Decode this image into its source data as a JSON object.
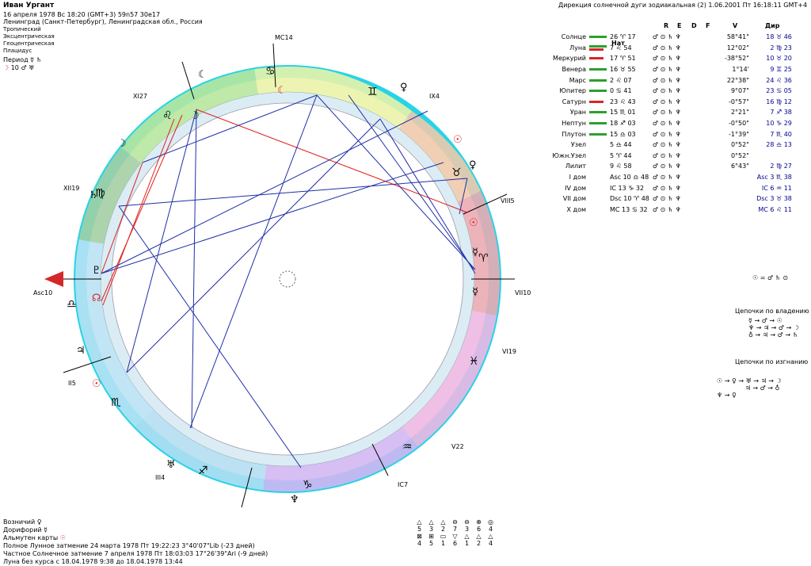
{
  "header": {
    "name": "Иван Ургант",
    "date_line": "16 апреля 1978  Вс  18:20 (GMT+3) 59n57  30e17",
    "place_line": "Ленинград (Санкт-Петербург), Ленинградская обл., Россия"
  },
  "settings": [
    "Тропический",
    "Эксцентрическая",
    "Геоцентрическая",
    "Плацидус"
  ],
  "period": {
    "label": "Период",
    "value": "10"
  },
  "direction_title": "Дирекция солнечной дуги зодиакальная (2)  1.06.2001  Пт 16:18:11 GMT+4",
  "table_headers": {
    "nat": "Нат",
    "R": "R",
    "E": "E",
    "D": "D",
    "F": "F",
    "V": "V",
    "dir": "Дир"
  },
  "planets": [
    {
      "name": "Солнце",
      "pos": "26 ♈ 17",
      "aspect": "58°41\"",
      "dir": "18 ♉ 46",
      "bar": "g"
    },
    {
      "name": "Луна",
      "pos": "7 ♌ 54",
      "aspect": "12°02\"",
      "dir": "2 ♍ 23",
      "bar": "gr"
    },
    {
      "name": "Меркурий",
      "pos": "17 ♈ 51",
      "aspect": "-38°52\"",
      "dir": "10 ♉ 20",
      "bar": "r"
    },
    {
      "name": "Венера",
      "pos": "16 ♉ 55",
      "aspect": "1°14'",
      "dir": "9 ♊ 25",
      "bar": "g"
    },
    {
      "name": "Марс",
      "pos": "2 ♌ 07",
      "aspect": "22°38\"",
      "dir": "24 ♌ 36",
      "bar": "g"
    },
    {
      "name": "Юпитер",
      "pos": "0 ♋ 41",
      "aspect": "9°07\"",
      "dir": "23 ♋ 05",
      "bar": "g"
    },
    {
      "name": "Сатурн",
      "pos": "23 ♌ 43",
      "aspect": "-0°57\"",
      "dir": "16 ♍ 12",
      "bar": "r"
    },
    {
      "name": "Уран",
      "pos": "15 ♏ 01",
      "aspect": "2°21\"",
      "dir": "7 ♐ 38",
      "bar": "g"
    },
    {
      "name": "Нептун",
      "pos": "18 ♐ 03",
      "aspect": "-0°50\"",
      "dir": "10 ♑ 29",
      "bar": "g"
    },
    {
      "name": "Плутон",
      "pos": "15 ♎ 03",
      "aspect": "-1°39\"",
      "dir": "7 ♏ 40",
      "bar": "g"
    },
    {
      "name": "Узел",
      "pos": "5 ♎ 44",
      "aspect": "0°52\"",
      "dir": "28 ♎ 13",
      "bar": ""
    },
    {
      "name": "Южн.Узел",
      "pos": "5 ♈ 44",
      "aspect": "0°52\"",
      "dir": "",
      "bar": ""
    },
    {
      "name": "Лилит",
      "pos": "9 ♌ 58",
      "aspect": "6°43\"",
      "dir": "2 ♍ 27",
      "bar": ""
    },
    {
      "name": "I дом",
      "pos": "Asc 10 ♎ 48",
      "aspect": "",
      "dir": "Asc 3 ♏ 38",
      "bar": ""
    },
    {
      "name": "IV дом",
      "pos": "IC 13 ♑ 32",
      "aspect": "",
      "dir": "IC 6 ♒ 11",
      "bar": ""
    },
    {
      "name": "VII дом",
      "pos": "Dsc 10 ♈ 48",
      "aspect": "",
      "dir": "Dsc 3 ♉ 38",
      "bar": ""
    },
    {
      "name": "X дом",
      "pos": "MC 13 ♋ 32",
      "aspect": "",
      "dir": "MC 6 ♌ 11",
      "bar": ""
    }
  ],
  "chains": {
    "ownership_title": "Цепочки по владению",
    "exile_title": "Цепочки по изгнанию"
  },
  "bottom": {
    "voznichiy": "Возничий",
    "dorifory": "Дорифорий",
    "almuten": "Альмутен карты",
    "lunar_eclipse": "Полное Лунное затмение 24 марта 1978 Пт 19:22:23  3°40'07\"Lib (-23 дней)",
    "solar_eclipse": "Частное Солнечное затмение 7 апреля 1978 Пт 18:03:03 17°26'39\"Ari (-9 дней)",
    "moon_void": "Луна без курса с 18.04.1978  9:38 до 18.04.1978 13:44"
  },
  "aspect_counts": {
    "row1": [
      "5",
      "3",
      "2",
      "7",
      "3",
      "6",
      "4"
    ],
    "row2": [
      "4",
      "5",
      "1",
      "6",
      "1",
      "2",
      "4"
    ]
  },
  "houses": [
    "Asc10",
    "II5",
    "III4",
    "IC7",
    "V22",
    "VI19",
    "VII10",
    "VIII5",
    "IX4",
    "MC14",
    "XI27",
    "XII19"
  ],
  "colors": {
    "ring": "#29d3e6",
    "aspect_blue": "#1f2fa8",
    "aspect_red": "#e0201d"
  }
}
